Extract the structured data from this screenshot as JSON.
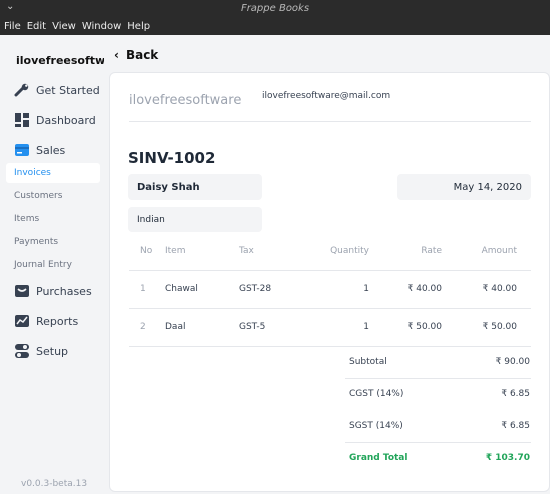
{
  "window": {
    "title": "Frappe Books"
  },
  "menu": [
    "File",
    "Edit",
    "View",
    "Window",
    "Help"
  ],
  "sidebar": {
    "company": "ilovefreesoftware",
    "items": [
      {
        "label": "Get Started",
        "icon": "wrench-icon"
      },
      {
        "label": "Dashboard",
        "icon": "dashboard-icon"
      },
      {
        "label": "Sales",
        "icon": "sales-card-icon"
      },
      {
        "label": "Purchases",
        "icon": "purchases-box-icon"
      },
      {
        "label": "Reports",
        "icon": "reports-chart-icon"
      },
      {
        "label": "Setup",
        "icon": "setup-toggle-icon"
      }
    ],
    "sales_sub": [
      "Invoices",
      "Customers",
      "Items",
      "Payments",
      "Journal Entry"
    ],
    "version": "v0.0.3-beta.13"
  },
  "back_label": "Back",
  "invoice": {
    "company": "ilovefreesoftware",
    "email": "ilovefreesoftware@mail.com",
    "number": "SINV-1002",
    "customer": "Daisy Shah",
    "date": "May 14, 2020",
    "place": "Indian",
    "columns": [
      "No",
      "Item",
      "Tax",
      "Quantity",
      "Rate",
      "Amount"
    ],
    "rows": [
      {
        "no": "1",
        "item": "Chawal",
        "tax": "GST-28",
        "qty": "1",
        "rate": "₹ 40.00",
        "amount": "₹ 40.00"
      },
      {
        "no": "2",
        "item": "Daal",
        "tax": "GST-5",
        "qty": "1",
        "rate": "₹ 50.00",
        "amount": "₹ 50.00"
      }
    ],
    "totals": {
      "subtotal_label": "Subtotal",
      "subtotal": "₹ 90.00",
      "cgst_label": "CGST (14%)",
      "cgst": "₹ 6.85",
      "sgst_label": "SGST (14%)",
      "sgst": "₹ 6.85",
      "grand_label": "Grand Total",
      "grand": "₹ 103.70"
    }
  },
  "colors": {
    "accent": "#2490ef",
    "grand_total": "#22a55a",
    "titlebar": "#2b2b2b"
  }
}
